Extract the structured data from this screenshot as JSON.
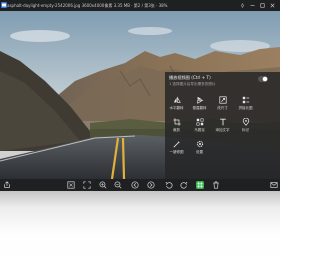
{
  "window": {
    "title": "asphalt-daylight-empty-2542006.jpg  3600x4000像素  3.35 MB  ·  第2 / 第3张  ·  38%"
  },
  "panel": {
    "header": "播放视频图  (Ctrl + T)",
    "subtitle": "1 选择图片后导出需多张照片",
    "tools": [
      {
        "label": "水平翻转",
        "icon": "flip-horizontal-icon"
      },
      {
        "label": "垂直翻转",
        "icon": "flip-vertical-icon"
      },
      {
        "label": "改尺寸",
        "icon": "resize-icon"
      },
      {
        "label": "拼接长图",
        "icon": "long-image-icon"
      },
      {
        "label": "",
        "icon": ""
      },
      {
        "label": "裁剪",
        "icon": "crop-icon"
      },
      {
        "label": "马赛克",
        "icon": "mosaic-icon"
      },
      {
        "label": "添加文字",
        "icon": "text-icon"
      },
      {
        "label": "标记",
        "icon": "location-pin-icon"
      },
      {
        "label": "",
        "icon": ""
      },
      {
        "label": "一键修图",
        "icon": "magic-wand-icon"
      },
      {
        "label": "设置",
        "icon": "settings-icon"
      }
    ]
  },
  "colors": {
    "chrome": "#1f2022",
    "panel": "#262628",
    "accent_green": "#2fb34a"
  }
}
